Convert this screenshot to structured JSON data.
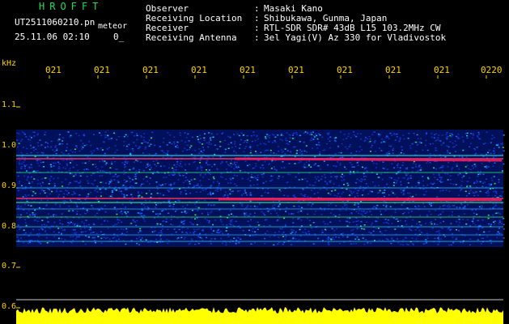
{
  "header": {
    "app_title": "HROFFT",
    "file_name": "UT2511060210.pn",
    "file_tag": "meteor",
    "timestamp": "25.11.06 02:10",
    "timestamp_extra": "0_",
    "fields": [
      {
        "label": "Observer",
        "sep": ":",
        "value": "Masaki Kano"
      },
      {
        "label": "Receiving Location",
        "sep": ":",
        "value": "Shibukawa, Gunma, Japan"
      },
      {
        "label": "Receiver",
        "sep": ":",
        "value": "RTL-SDR SDR# 43dB L15 103.2MHz CW"
      },
      {
        "label": "Receiving Antenna",
        "sep": ":",
        "value": "3el Yagi(V) Az 330 for Vladivostok"
      }
    ]
  },
  "y_axis": {
    "unit": "kHz",
    "ticks": [
      "1.1",
      "1.0",
      "0.9",
      "0.8",
      "0.7",
      "0.6"
    ]
  },
  "x_axis": {
    "ticks": [
      "021",
      "021",
      "021",
      "021",
      "021",
      "021",
      "021",
      "021",
      "021",
      "0220"
    ]
  },
  "colors": {
    "text": "#ffffff",
    "title": "#19e05a",
    "axis": "#ffd400",
    "background": "#000000"
  }
}
